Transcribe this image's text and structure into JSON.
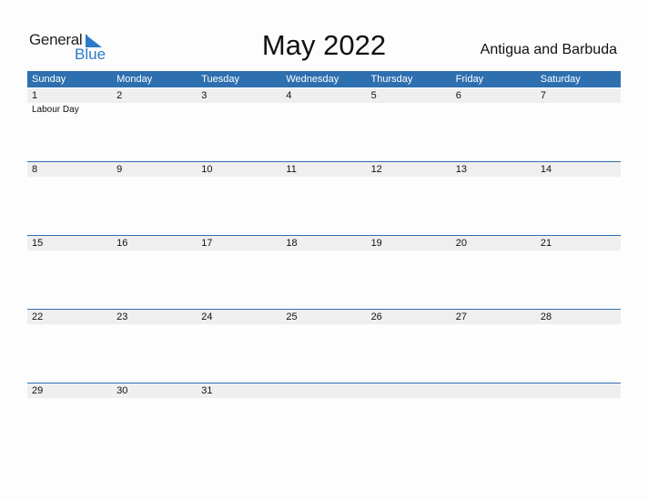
{
  "logo": {
    "word1": "General",
    "word2": "Blue",
    "brand_color": "#2a7bc8"
  },
  "title": "May 2022",
  "country": "Antigua and Barbuda",
  "colors": {
    "header_bg": "#2e6fb0",
    "date_strip_bg": "#efefef"
  },
  "weekdays": [
    "Sunday",
    "Monday",
    "Tuesday",
    "Wednesday",
    "Thursday",
    "Friday",
    "Saturday"
  ],
  "weeks": [
    {
      "days": [
        {
          "num": "1",
          "event": "Labour Day"
        },
        {
          "num": "2",
          "event": ""
        },
        {
          "num": "3",
          "event": ""
        },
        {
          "num": "4",
          "event": ""
        },
        {
          "num": "5",
          "event": ""
        },
        {
          "num": "6",
          "event": ""
        },
        {
          "num": "7",
          "event": ""
        }
      ]
    },
    {
      "days": [
        {
          "num": "8",
          "event": ""
        },
        {
          "num": "9",
          "event": ""
        },
        {
          "num": "10",
          "event": ""
        },
        {
          "num": "11",
          "event": ""
        },
        {
          "num": "12",
          "event": ""
        },
        {
          "num": "13",
          "event": ""
        },
        {
          "num": "14",
          "event": ""
        }
      ]
    },
    {
      "days": [
        {
          "num": "15",
          "event": ""
        },
        {
          "num": "16",
          "event": ""
        },
        {
          "num": "17",
          "event": ""
        },
        {
          "num": "18",
          "event": ""
        },
        {
          "num": "19",
          "event": ""
        },
        {
          "num": "20",
          "event": ""
        },
        {
          "num": "21",
          "event": ""
        }
      ]
    },
    {
      "days": [
        {
          "num": "22",
          "event": ""
        },
        {
          "num": "23",
          "event": ""
        },
        {
          "num": "24",
          "event": ""
        },
        {
          "num": "25",
          "event": ""
        },
        {
          "num": "26",
          "event": ""
        },
        {
          "num": "27",
          "event": ""
        },
        {
          "num": "28",
          "event": ""
        }
      ]
    },
    {
      "days": [
        {
          "num": "29",
          "event": ""
        },
        {
          "num": "30",
          "event": ""
        },
        {
          "num": "31",
          "event": ""
        },
        {
          "num": "",
          "event": ""
        },
        {
          "num": "",
          "event": ""
        },
        {
          "num": "",
          "event": ""
        },
        {
          "num": "",
          "event": ""
        }
      ]
    }
  ]
}
